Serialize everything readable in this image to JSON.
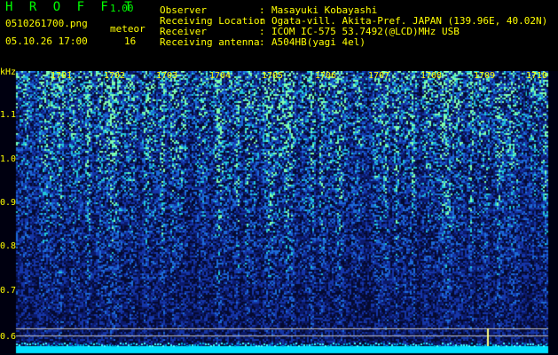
{
  "app": {
    "title": "H R O F F T",
    "version": "1.00"
  },
  "file": {
    "name": "0510261700.png",
    "datetime": "05.10.26 17:00"
  },
  "meteor": {
    "label": "meteor",
    "count": "16"
  },
  "meta": [
    {
      "label": "Observer",
      "sep": ":",
      "value": "Masayuki Kobayashi"
    },
    {
      "label": "Receiving Location",
      "sep": ":",
      "value": "Ogata-vill. Akita-Pref. JAPAN (139.96E, 40.02N)"
    },
    {
      "label": "Receiver",
      "sep": ":",
      "value": "ICOM IC-575 53.7492(@LCD)MHz USB"
    },
    {
      "label": "Receiving antenna",
      "sep": ":",
      "value": "A504HB(yagi 4el)"
    }
  ],
  "axis": {
    "y_unit": "kHz",
    "y_ticks": [
      "1.1",
      "1.0",
      "0.9",
      "0.8",
      "0.7",
      "0.6"
    ],
    "x_ticks": [
      "1701",
      "1702",
      "1703",
      "1704",
      "1705",
      "1706",
      "1707",
      "1708",
      "1709",
      "1710"
    ]
  },
  "colors": {
    "text": "#ffff00",
    "title": "#00ff00",
    "bg": "#000000",
    "band": "#00ffff"
  }
}
